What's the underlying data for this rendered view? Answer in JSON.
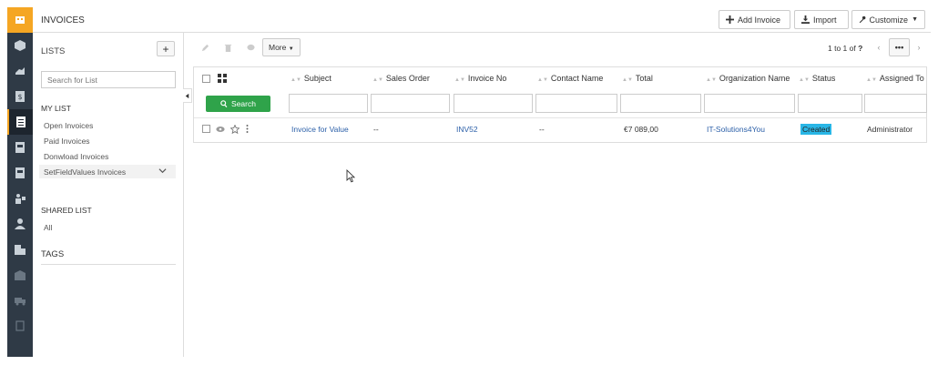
{
  "header": {
    "title": "INVOICES",
    "buttons": [
      {
        "label": "Add Invoice",
        "icon": "plus-icon"
      },
      {
        "label": "Import",
        "icon": "import-icon"
      },
      {
        "label": "Customize",
        "icon": "wrench-icon"
      }
    ]
  },
  "sidebar": {
    "lists_title": "LISTS",
    "add_label": "+",
    "search_placeholder": "Search for List",
    "my_list_title": "MY LIST",
    "my_list": [
      "Open Invoices",
      "Paid Invoices",
      "Donwload Invoices",
      "SetFieldValues Invoices"
    ],
    "shared_title": "SHARED LIST",
    "shared": [
      "All"
    ],
    "tags_title": "TAGS"
  },
  "toolbar": {
    "more_label": "More",
    "pager_text": "1 to 1",
    "pager_of": "of",
    "pager_total": "?",
    "pager_dots": "•••"
  },
  "table": {
    "search_label": "Search",
    "columns": [
      "Subject",
      "Sales Order",
      "Invoice No",
      "Contact Name",
      "Total",
      "Organization Name",
      "Status",
      "Assigned To"
    ],
    "rows": [
      {
        "subject": "Invoice for Value",
        "sales_order": "--",
        "invoice_no": "INV52",
        "contact_name": "--",
        "total": "€7 089,00",
        "organization": "IT-Solutions4You",
        "status": "Created",
        "assigned_to": "Administrator"
      }
    ]
  },
  "colors": {
    "rail": "#2f3a46",
    "accent": "#f5a623",
    "search_button": "#2fa34a",
    "link": "#2b5fa8",
    "status_badge": "#29b6e6"
  },
  "rail_icons": [
    "app-logo-icon",
    "cube-icon",
    "hand-icon",
    "dollar-doc-icon",
    "invoice-icon",
    "so-doc-icon",
    "po-doc-icon",
    "vendor-icon",
    "contact-icon",
    "organization-icon",
    "warehouse-icon",
    "truck-icon",
    "document-icon"
  ]
}
